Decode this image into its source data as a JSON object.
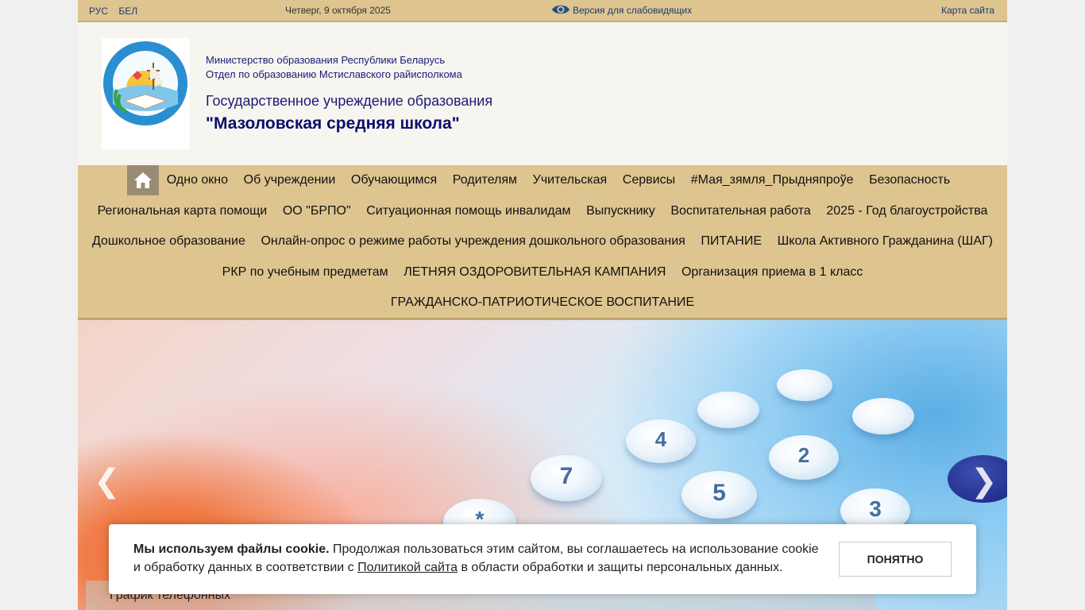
{
  "topbar": {
    "lang_ru": "РУС",
    "lang_be": "БЕЛ",
    "date": "Четверг, 9 октября 2025",
    "vision_label": "Версия для слабовидящих",
    "sitemap": "Карта сайта"
  },
  "header": {
    "ministry_line1": "Министерство образования Республики Беларусь",
    "ministry_line2": "Отдел по образованию Мстиславского райисполкома",
    "org_type": "Государственное учреждение образования",
    "school_name": "\"Мазоловская средняя школа\""
  },
  "nav": {
    "rows": [
      [
        "Одно окно",
        "Об учреждении",
        "Обучающимся",
        "Родителям",
        "Учительская",
        "Сервисы",
        "#Мая_зямля_Прыдняпроўе",
        "Безопасность"
      ],
      [
        "Региональная карта помощи",
        "ОО \"БРПО\"",
        "Ситуационная помощь инвалидам",
        "Выпускнику",
        "Воспитательная работа",
        "2025 - Год благоустройства"
      ],
      [
        "Дошкольное образование",
        "Онлайн-опрос о режиме работы учреждения дошкольного образования",
        "ПИТАНИЕ",
        "Школа Активного Гражданина (ШАГ)"
      ],
      [
        "РКР по учебным предметам",
        "ЛЕТНЯЯ ОЗДОРОВИТЕЛЬНАЯ КАМПАНИЯ",
        "Организация приема в 1 класс"
      ],
      [
        "ГРАЖДАНСКО-ПАТРИОТИЧЕСКОЕ ВОСПИТАНИЕ"
      ]
    ]
  },
  "slider": {
    "caption": "График телефонных",
    "keys": [
      "7",
      "4",
      "5",
      "2",
      "3",
      "*"
    ]
  },
  "cookie": {
    "bold": "Мы используем файлы cookie.",
    "text1": " Продолжая пользоваться этим сайтом, вы соглашаетесь на использование cookie и обработку данных в соответствии с ",
    "link": "Политикой сайта",
    "text2": " в области обработки и защиты персональных данных.",
    "button": "ПОНЯТНО"
  },
  "colors": {
    "topbar_bg": "#dec590",
    "nav_bg": "#dec590",
    "home_bg": "#9a8b74",
    "title_blue": "#1b1b7a"
  }
}
